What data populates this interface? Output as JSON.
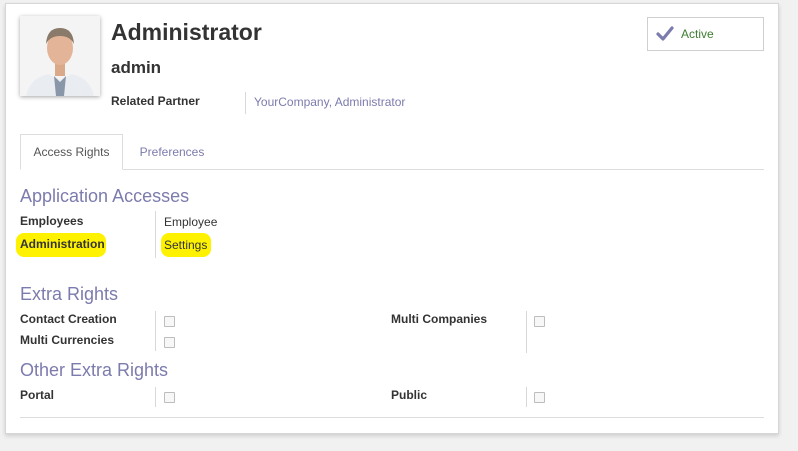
{
  "user": {
    "name": "Administrator",
    "login": "admin",
    "related_partner_label": "Related Partner",
    "related_partner_value": "YourCompany, Administrator"
  },
  "status_button": {
    "label": "Active"
  },
  "tabs": [
    {
      "label": "Access Rights",
      "active": true
    },
    {
      "label": "Preferences",
      "active": false
    }
  ],
  "application_accesses": {
    "heading": "Application Accesses",
    "rows": [
      {
        "label": "Employees",
        "value": "Employee"
      },
      {
        "label": "Administration",
        "value": "Settings"
      }
    ]
  },
  "extra_rights": {
    "heading": "Extra Rights",
    "left": [
      {
        "label": "Contact Creation",
        "checked": false
      },
      {
        "label": "Multi Currencies",
        "checked": false
      }
    ],
    "right": [
      {
        "label": "Multi Companies",
        "checked": false
      }
    ]
  },
  "other_extra_rights": {
    "heading": "Other Extra Rights",
    "left": [
      {
        "label": "Portal",
        "checked": false
      }
    ],
    "right": [
      {
        "label": "Public",
        "checked": false
      }
    ]
  },
  "colors": {
    "accent": "#7c7bad",
    "active_text": "#3c7d30",
    "highlight": "#fff200"
  }
}
